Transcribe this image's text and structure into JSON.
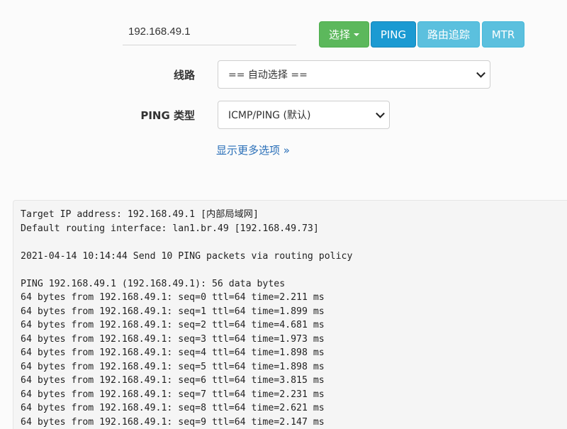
{
  "target": {
    "ip_value": "192.168.49.1"
  },
  "buttons": {
    "select_label": "选择",
    "ping_label": "PING",
    "traceroute_label": "路由追踪",
    "mtr_label": "MTR"
  },
  "form": {
    "route_label": "线路",
    "route_value": "== 自动选择 ==",
    "ping_type_label": "PING 类型",
    "ping_type_value": "ICMP/PING (默认)",
    "more_options_link": "显示更多选项 »"
  },
  "output": {
    "lines": [
      "Target IP address: 192.168.49.1 [内部局域网]",
      "Default routing interface: lan1.br.49 [192.168.49.73]",
      "",
      "2021-04-14 10:14:44 Send 10 PING packets via routing policy",
      "",
      "PING 192.168.49.1 (192.168.49.1): 56 data bytes",
      "64 bytes from 192.168.49.1: seq=0 ttl=64 time=2.211 ms",
      "64 bytes from 192.168.49.1: seq=1 ttl=64 time=1.899 ms",
      "64 bytes from 192.168.49.1: seq=2 ttl=64 time=4.681 ms",
      "64 bytes from 192.168.49.1: seq=3 ttl=64 time=1.973 ms",
      "64 bytes from 192.168.49.1: seq=4 ttl=64 time=1.898 ms",
      "64 bytes from 192.168.49.1: seq=5 ttl=64 time=1.898 ms",
      "64 bytes from 192.168.49.1: seq=6 ttl=64 time=3.815 ms",
      "64 bytes from 192.168.49.1: seq=7 ttl=64 time=2.231 ms",
      "64 bytes from 192.168.49.1: seq=8 ttl=64 time=2.621 ms",
      "64 bytes from 192.168.49.1: seq=9 ttl=64 time=2.147 ms"
    ]
  },
  "colors": {
    "select_button": "#5cb85c",
    "ping_button": "#1b9ad2",
    "traceroute_button": "#5bc0de",
    "mtr_button": "#5bc0de",
    "link": "#2a6fb8"
  },
  "icons": {
    "select_caret": "caret-down-icon",
    "dropdown_chevron": "chevron-down-icon"
  }
}
